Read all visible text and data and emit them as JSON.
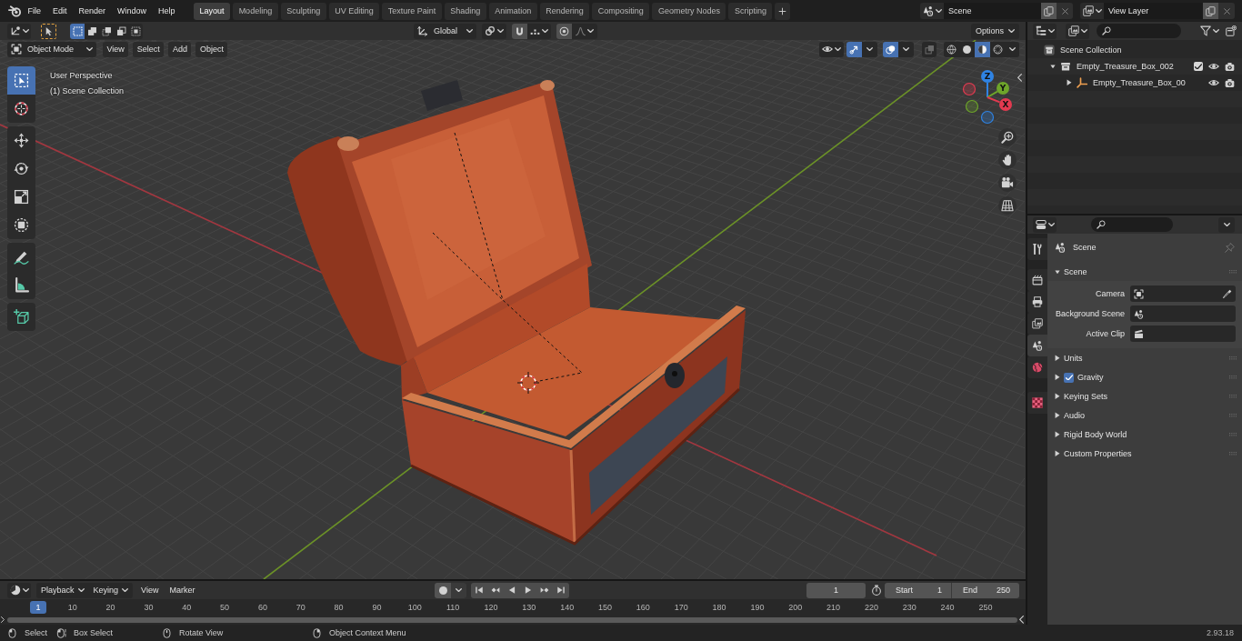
{
  "topbar": {
    "menus": [
      "File",
      "Edit",
      "Render",
      "Window",
      "Help"
    ],
    "workspaces": [
      {
        "label": "Layout",
        "selected": true
      },
      {
        "label": "Modeling",
        "selected": false
      },
      {
        "label": "Sculpting",
        "selected": false
      },
      {
        "label": "UV Editing",
        "selected": false
      },
      {
        "label": "Texture Paint",
        "selected": false
      },
      {
        "label": "Shading",
        "selected": false
      },
      {
        "label": "Animation",
        "selected": false
      },
      {
        "label": "Rendering",
        "selected": false
      },
      {
        "label": "Compositing",
        "selected": false
      },
      {
        "label": "Geometry Nodes",
        "selected": false
      },
      {
        "label": "Scripting",
        "selected": false
      }
    ],
    "scene": "Scene",
    "view_layer": "View Layer"
  },
  "viewport": {
    "select_modes": [
      {
        "selected": true
      },
      {
        "selected": false
      },
      {
        "selected": false
      },
      {
        "selected": false
      },
      {
        "selected": false
      }
    ],
    "orientation": "Global",
    "options": "Options",
    "mode": "Object Mode",
    "menus": [
      "View",
      "Select",
      "Add",
      "Object"
    ],
    "gizmos_on": true,
    "overlays_on": true,
    "shading": [
      {
        "selected": false
      },
      {
        "selected": false
      },
      {
        "selected": true
      },
      {
        "selected": false
      }
    ],
    "info": [
      "User Perspective",
      "(1) Scene Collection"
    ],
    "tools": [
      {
        "selected": true
      },
      {
        "selected": false
      },
      {
        "selected": false
      },
      {
        "selected": false
      },
      {
        "selected": false
      },
      {
        "selected": false
      },
      {
        "selected": false
      },
      {
        "selected": false
      },
      {
        "selected": false
      }
    ],
    "axes": [
      {
        "label": "Z",
        "color": "#2f83e3"
      },
      {
        "label": "Y",
        "color": "#6ea52a"
      },
      {
        "label": "X",
        "color": "#e23a50"
      }
    ]
  },
  "outliner": {
    "tree": [
      {
        "kind": "root",
        "label": "Scene Collection",
        "children": [
          {
            "kind": "collection",
            "label": "Empty_Treasure_Box_002",
            "expanded": true,
            "checked": true,
            "children": [
              {
                "kind": "empty",
                "label": "Empty_Treasure_Box_00",
                "expanded": false
              }
            ]
          }
        ]
      }
    ]
  },
  "properties": {
    "tabs": [
      {
        "selected": false
      },
      {
        "selected": false
      },
      {
        "selected": false
      },
      {
        "selected": false
      },
      {
        "selected": true
      },
      {
        "selected": false
      },
      {
        "selected": false
      }
    ],
    "context": "Scene",
    "panels": [
      {
        "label": "Scene",
        "expanded": true,
        "fields": [
          {
            "label": "Camera"
          },
          {
            "label": "Background Scene"
          },
          {
            "label": "Active Clip"
          }
        ]
      },
      {
        "label": "Units",
        "expanded": false
      },
      {
        "label": "Gravity",
        "expanded": false,
        "checked": true
      },
      {
        "label": "Keying Sets",
        "expanded": false
      },
      {
        "label": "Audio",
        "expanded": false
      },
      {
        "label": "Rigid Body World",
        "expanded": false
      },
      {
        "label": "Custom Properties",
        "expanded": false
      }
    ]
  },
  "timeline": {
    "dropdowns": [
      "Playback",
      "Keying"
    ],
    "menus": [
      "View",
      "Marker"
    ],
    "current_frame": "1",
    "start": {
      "label": "Start",
      "value": "1"
    },
    "end": {
      "label": "End",
      "value": "250"
    },
    "playhead": "1",
    "ticks": [
      "10",
      "20",
      "30",
      "40",
      "50",
      "60",
      "70",
      "80",
      "90",
      "100",
      "110",
      "120",
      "130",
      "140",
      "150",
      "160",
      "170",
      "180",
      "190",
      "200",
      "210",
      "220",
      "230",
      "240",
      "250"
    ]
  },
  "status_bar": {
    "hints": [
      "Select",
      "Box Select",
      "Rotate View",
      "Object Context Menu"
    ],
    "version": "2.93.18"
  }
}
